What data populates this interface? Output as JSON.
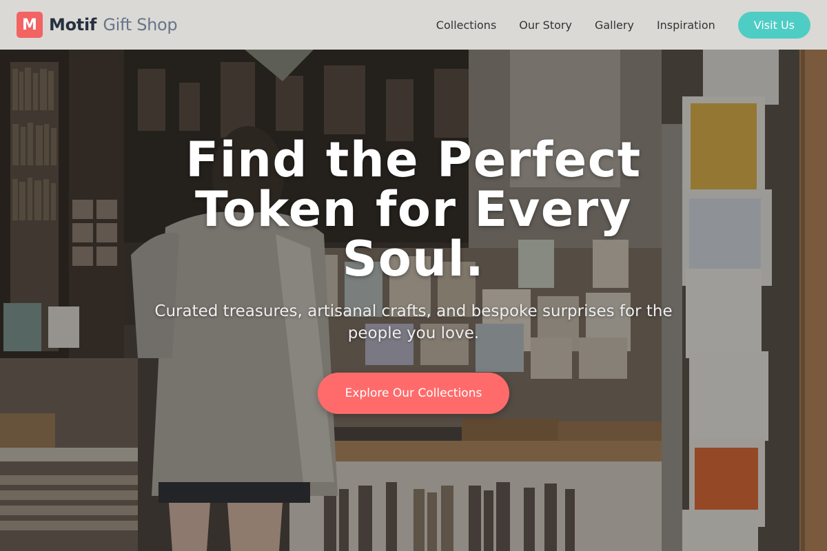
{
  "header": {
    "logo_letter": "M",
    "brand_name": "Motif",
    "brand_sub": "Gift Shop",
    "nav": [
      {
        "label": "Collections"
      },
      {
        "label": "Our Story"
      },
      {
        "label": "Gallery"
      },
      {
        "label": "Inspiration"
      }
    ],
    "cta_label": "Visit Us"
  },
  "hero": {
    "title": "Find the Perfect Token for Every Soul.",
    "subtitle": "Curated treasures, artisanal crafts, and bespoke surprises for the people you love.",
    "button_label": "Explore Our Collections",
    "background_icon": "gift-shop-photo"
  },
  "colors": {
    "logo": "#f26363",
    "brand_name": "#26303f",
    "brand_sub": "#66758a",
    "cta": "#4ecdc4",
    "hero_button": "#ff6b6b",
    "header_bg": "#e8e6e2"
  }
}
